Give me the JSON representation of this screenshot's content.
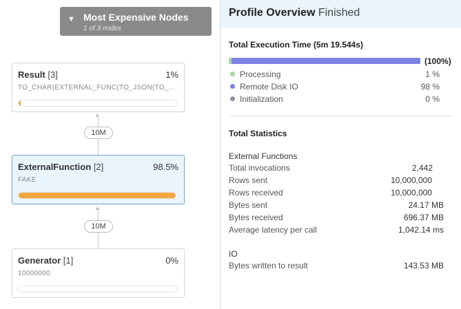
{
  "graph": {
    "expensive_nodes": {
      "title": "Most Expensive Nodes",
      "subtitle": "1 of 3 nodes",
      "icon": "chevron-down-icon"
    },
    "nodes": [
      {
        "name": "Result",
        "index": "[3]",
        "percent": "1%",
        "detail": "TO_CHAR(EXTERNAL_FUNC(TO_JSON(TO_...",
        "bar_fraction": 0.01,
        "selected": false
      },
      {
        "name": "ExternalFunction",
        "index": "[2]",
        "percent": "98.5%",
        "detail": "FAKE",
        "bar_fraction": 0.985,
        "selected": true
      },
      {
        "name": "Generator",
        "index": "[1]",
        "percent": "0%",
        "detail": "10000000",
        "bar_fraction": 0.0,
        "selected": false
      }
    ],
    "edges": [
      {
        "label": "10M"
      },
      {
        "label": "10M"
      }
    ]
  },
  "profile": {
    "title": "Profile Overview",
    "status": "Finished",
    "execution": {
      "title": "Total Execution Time (5m 19.544s)",
      "total_percent": "(100%)",
      "rows": [
        {
          "label": "Processing",
          "value": "1 %",
          "fraction": 0.01,
          "color": "#a8d8a0"
        },
        {
          "label": "Remote Disk IO",
          "value": "98 %",
          "fraction": 0.98,
          "color": "#7c83e4"
        },
        {
          "label": "Initialization",
          "value": "0 %",
          "fraction": 0.0,
          "color": "#8f8fa8"
        }
      ]
    },
    "statistics": {
      "title": "Total Statistics",
      "groups": [
        {
          "title": "External Functions",
          "rows": [
            {
              "label": "Total invocations",
              "value": "2,442"
            },
            {
              "label": "Rows sent",
              "value": "10,000,000"
            },
            {
              "label": "Rows received",
              "value": "10,000,000"
            },
            {
              "label": "Bytes sent",
              "value": "24.17 MB"
            },
            {
              "label": "Bytes received",
              "value": "696.37 MB"
            },
            {
              "label": "Average latency per call",
              "value": "1,042.14 ms"
            }
          ]
        },
        {
          "title": "IO",
          "rows": [
            {
              "label": "Bytes written to result",
              "value": "143.53 MB"
            }
          ]
        }
      ]
    }
  }
}
